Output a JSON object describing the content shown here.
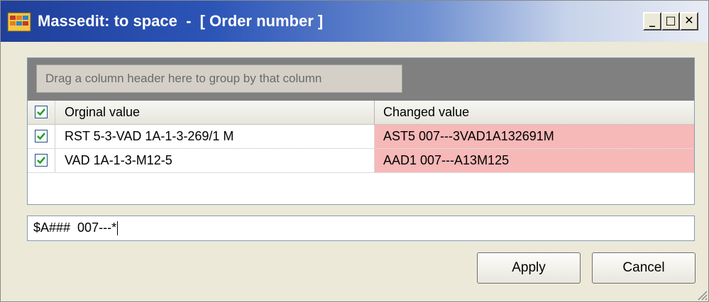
{
  "window": {
    "title": "Massedit: to space  -  [ Order number ]",
    "controls": {
      "minimize": "_",
      "maximize": "□",
      "close": "✕"
    }
  },
  "grid": {
    "group_hint": "Drag a column header here to group by that column",
    "columns": [
      "Orginal value",
      "Changed value"
    ],
    "rows": [
      {
        "checked": true,
        "original": "RST 5-3-VAD 1A-1-3-269/1 M",
        "changed": "AST5  007---3VAD1A132691M"
      },
      {
        "checked": true,
        "original": "VAD 1A-1-3-M12-5",
        "changed": "AAD1  007---A13M125"
      }
    ]
  },
  "pattern": {
    "value": "$A###  007---*"
  },
  "buttons": {
    "apply": "Apply",
    "cancel": "Cancel"
  },
  "colors": {
    "title_bar": "#2c55b8",
    "changed_highlight": "#f7b8b8",
    "group_panel": "#808080"
  },
  "icons": [
    "app-icon",
    "checkbox-icon",
    "size-grip-icon"
  ]
}
